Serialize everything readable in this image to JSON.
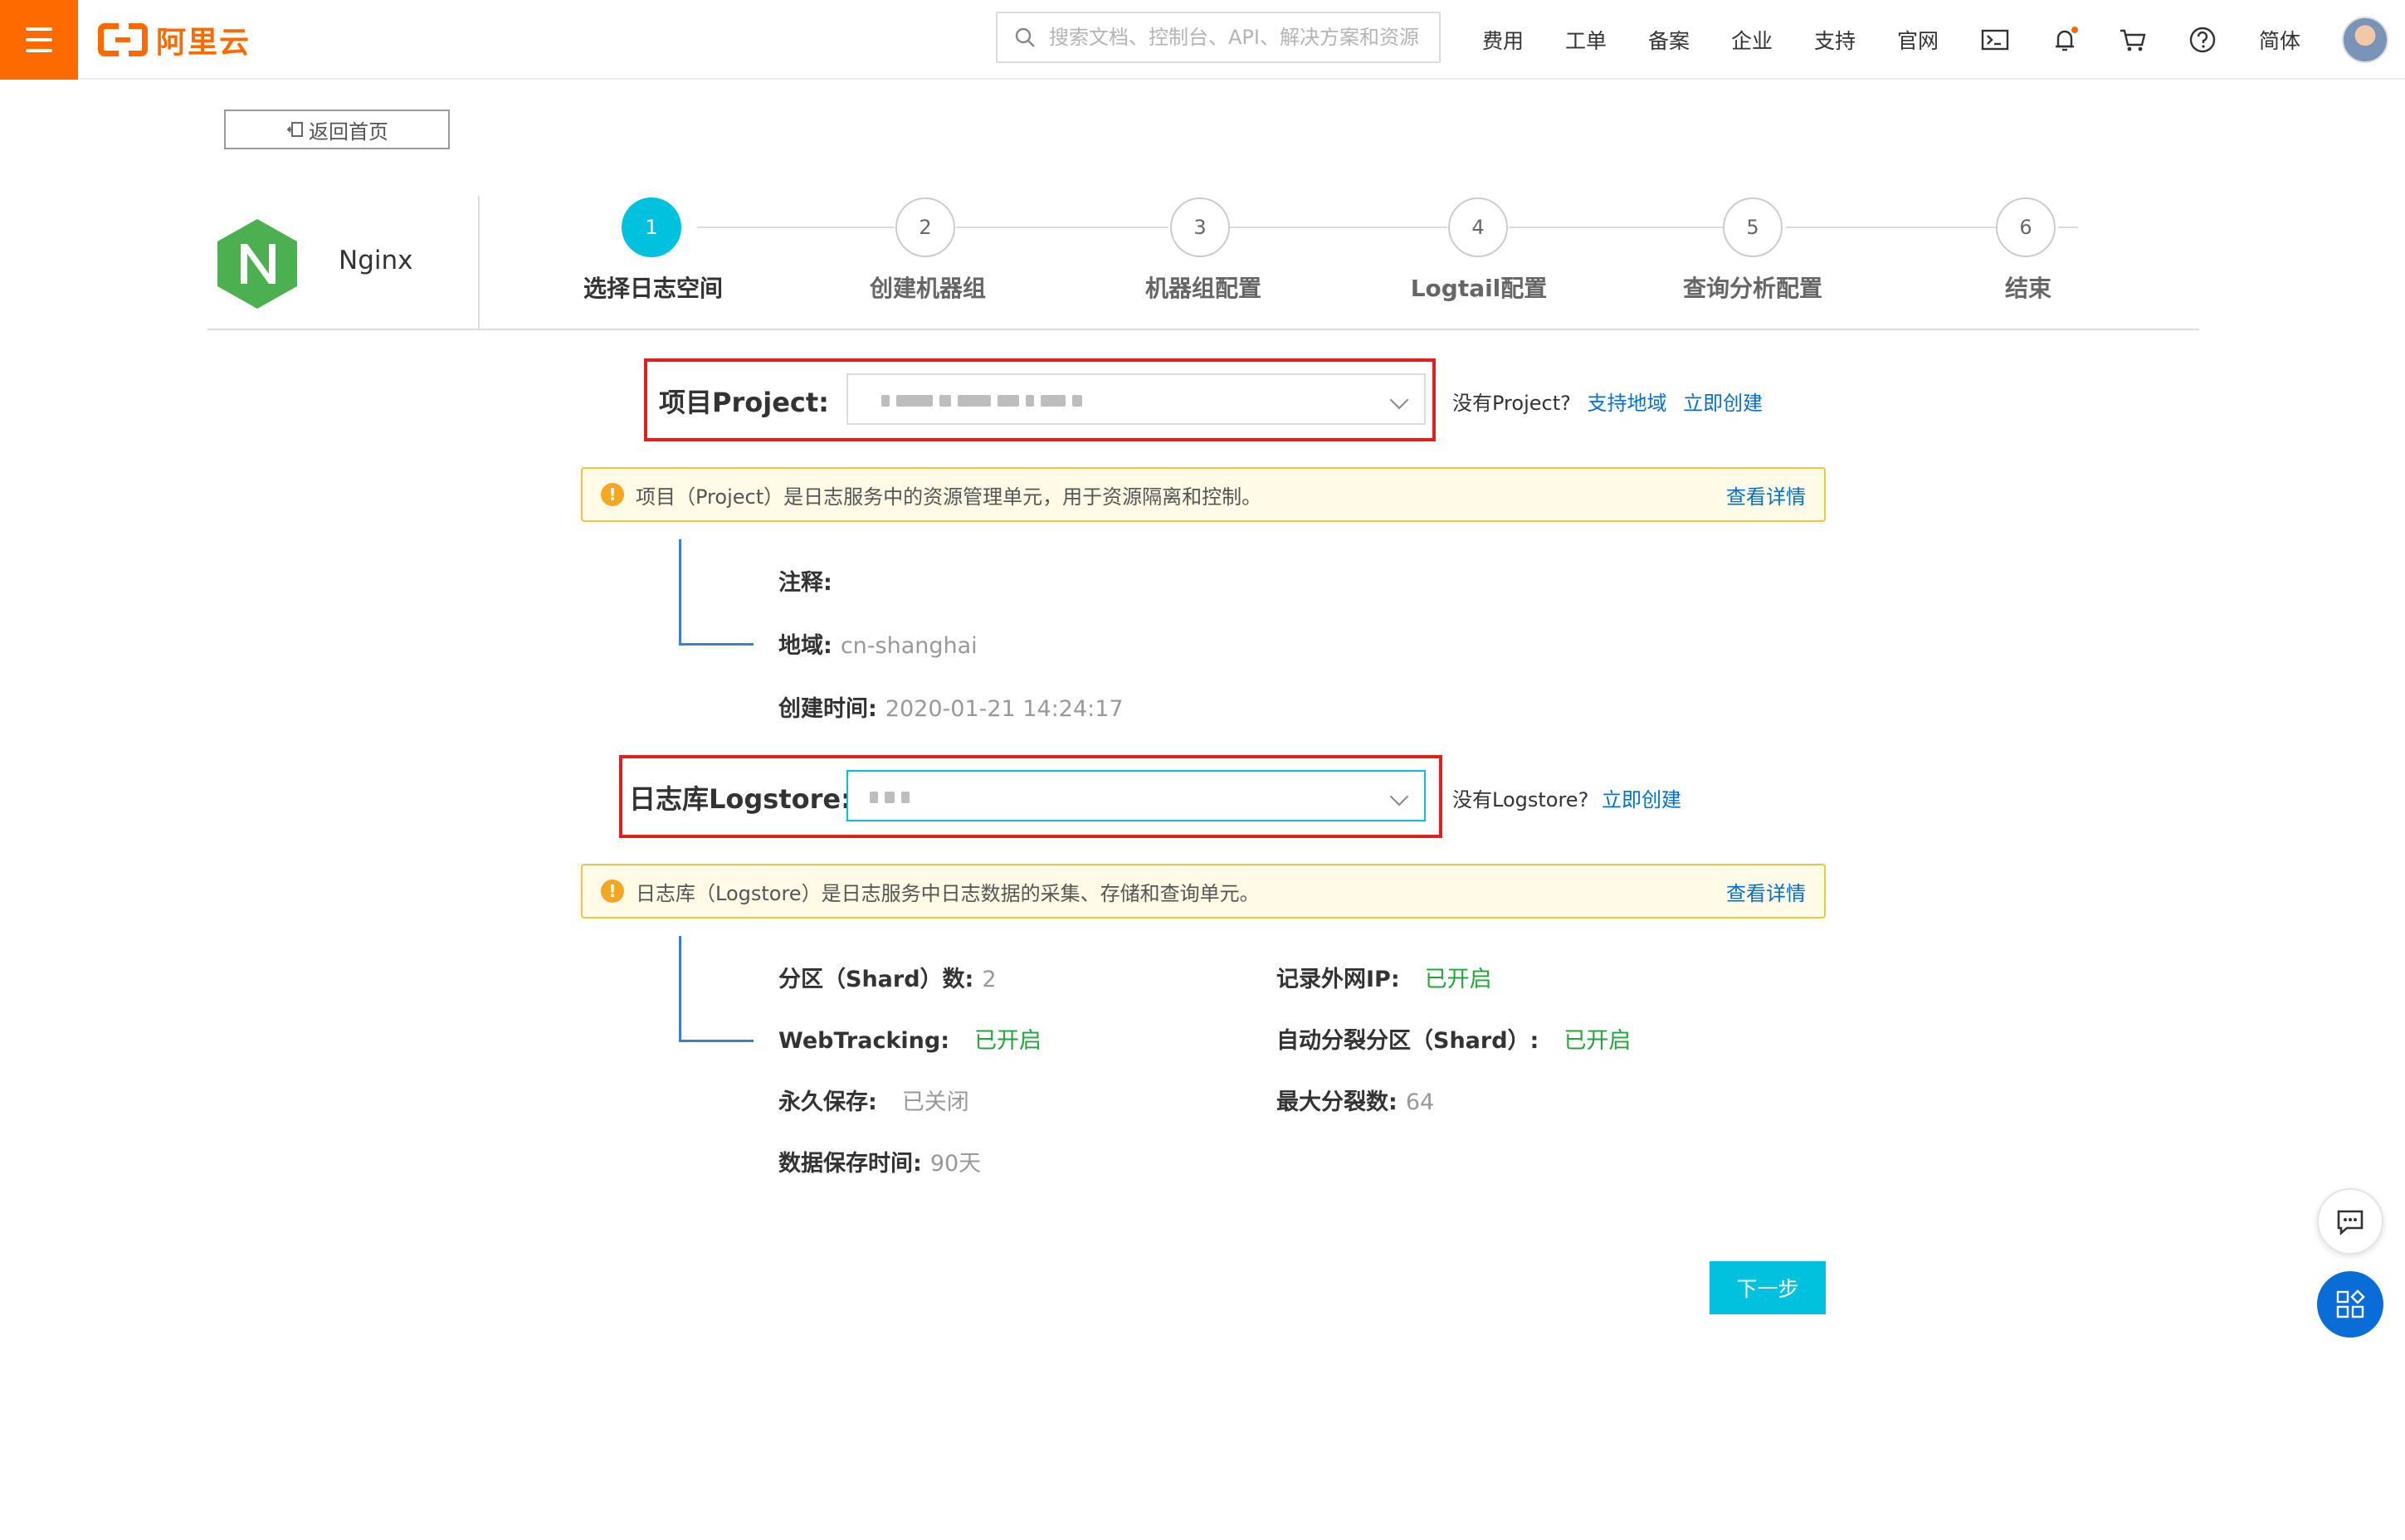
{
  "topbar": {
    "brand": "阿里云",
    "search_placeholder": "搜索文档、控制台、API、解决方案和资源",
    "nav": [
      "费用",
      "工单",
      "备案",
      "企业",
      "支持",
      "官网"
    ],
    "lang": "简体"
  },
  "back_label": "返回首页",
  "app_name": "Nginx",
  "steps": [
    {
      "num": "1",
      "label": "选择日志空间"
    },
    {
      "num": "2",
      "label": "创建机器组"
    },
    {
      "num": "3",
      "label": "机器组配置"
    },
    {
      "num": "4",
      "label": "Logtail配置"
    },
    {
      "num": "5",
      "label": "查询分析配置"
    },
    {
      "num": "6",
      "label": "结束"
    }
  ],
  "project": {
    "label": "项目Project:",
    "no_project": "没有Project?",
    "support_region": "支持地域",
    "create_now": "立即创建",
    "notice": "项目（Project）是日志服务中的资源管理单元，用于资源隔离和控制。",
    "notice_more": "查看详情",
    "comment_label": "注释:",
    "region_label": "地域:",
    "region_value": "cn-shanghai",
    "created_label": "创建时间:",
    "created_value": "2020-01-21 14:24:17"
  },
  "logstore": {
    "label": "日志库Logstore:",
    "no_logstore": "没有Logstore?",
    "create_now": "立即创建",
    "notice": "日志库（Logstore）是日志服务中日志数据的采集、存储和查询单元。",
    "notice_more": "查看详情",
    "shard_label": "分区（Shard）数:",
    "shard_value": "2",
    "webtracking_label": "WebTracking:",
    "webtracking_value": "已开启",
    "permanent_label": "永久保存:",
    "permanent_value": "已关闭",
    "retention_label": "数据保存时间:",
    "retention_value": "90天",
    "external_ip_label": "记录外网IP:",
    "external_ip_value": "已开启",
    "auto_split_label": "自动分裂分区（Shard）:",
    "auto_split_value": "已开启",
    "max_split_label": "最大分裂数:",
    "max_split_value": "64"
  },
  "next_label": "下一步",
  "colors": {
    "brand": "#ff6a00",
    "accent": "#00c1de",
    "link": "#0070cc",
    "success": "#22a53a",
    "highlight": "#e02020"
  }
}
